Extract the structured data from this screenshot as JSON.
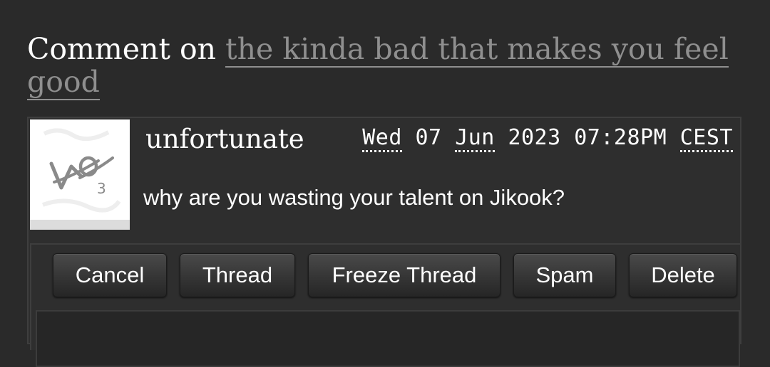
{
  "heading": {
    "prefix": "Comment on",
    "work_title": "the kinda bad that makes you feel good"
  },
  "comment": {
    "username": "unfortunate",
    "date": {
      "weekday": "Wed",
      "day": "07",
      "month": "Jun",
      "year": "2023",
      "time": "07:28PM",
      "timezone": "CEST"
    },
    "text": "why are you wasting your talent on Jikook?",
    "avatar_icon": "ao3-logo-icon"
  },
  "actions": {
    "cancel": "Cancel",
    "thread": "Thread",
    "freeze_thread": "Freeze Thread",
    "spam": "Spam",
    "delete": "Delete"
  },
  "colors": {
    "background": "#2a2a2a",
    "link": "#8f8f8f",
    "text": "#ffffff"
  }
}
